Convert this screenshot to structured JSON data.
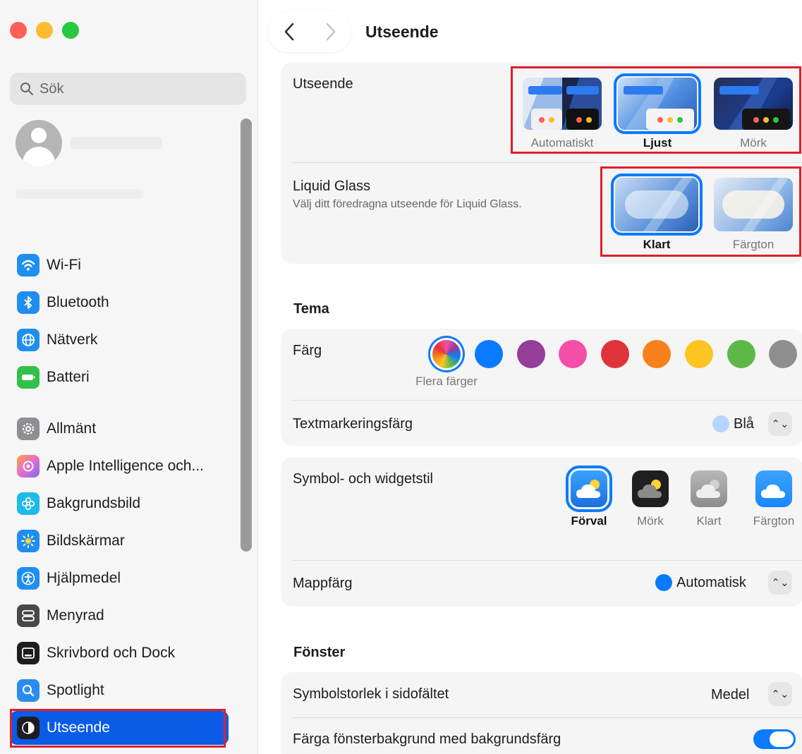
{
  "window": {
    "title": "Utseende"
  },
  "search": {
    "placeholder": "Sök"
  },
  "sidebar": {
    "groups": [
      [
        {
          "label": "Wi-Fi",
          "icon": "wifi-icon",
          "color": "#1e8ef0"
        },
        {
          "label": "Bluetooth",
          "icon": "bluetooth-icon",
          "color": "#1e8ef0"
        },
        {
          "label": "Nätverk",
          "icon": "globe-icon",
          "color": "#1e8ef0"
        },
        {
          "label": "Batteri",
          "icon": "battery-icon",
          "color": "#32c04a"
        }
      ],
      [
        {
          "label": "Allmänt",
          "icon": "gear-icon",
          "color": "#8e8e93"
        },
        {
          "label": "Apple Intelligence och...",
          "icon": "apple-intelligence-icon",
          "color": "#e86bd0"
        },
        {
          "label": "Bakgrundsbild",
          "icon": "flower-icon",
          "color": "#1ebbe8"
        },
        {
          "label": "Bildskärmar",
          "icon": "sun-icon",
          "color": "#1e8ef0"
        },
        {
          "label": "Hjälpmedel",
          "icon": "accessibility-icon",
          "color": "#1e8ef0"
        },
        {
          "label": "Menyrad",
          "icon": "menubar-icon",
          "color": "#48484a"
        },
        {
          "label": "Skrivbord och Dock",
          "icon": "dock-icon",
          "color": "#1d1d1f"
        },
        {
          "label": "Spotlight",
          "icon": "magnifier-icon",
          "color": "#2a8cf0"
        },
        {
          "label": "Utseende",
          "icon": "appearance-icon",
          "color": "#1d1d1f",
          "active": true
        }
      ]
    ]
  },
  "appearance": {
    "label": "Utseende",
    "options": [
      "Automatiskt",
      "Ljust",
      "Mörk"
    ],
    "selected": "Ljust"
  },
  "liquid_glass": {
    "label": "Liquid Glass",
    "description": "Välj ditt föredragna utseende för Liquid Glass.",
    "options": [
      "Klart",
      "Färgton"
    ],
    "selected": "Klart"
  },
  "theme": {
    "heading": "Tema",
    "color_label": "Färg",
    "colors": [
      "multicolor",
      "#0a7bff",
      "#953d9a",
      "#f44ea8",
      "#e0323a",
      "#f7821b",
      "#fdc521",
      "#5eb847",
      "#8e8e8e"
    ],
    "selected_color_name": "Flera färger",
    "highlight_label": "Textmarkeringsfärg",
    "highlight_value": "Blå",
    "highlight_swatch": "#b6d5fc"
  },
  "widget": {
    "label": "Symbol- och widgetstil",
    "options": [
      "Förval",
      "Mörk",
      "Klart",
      "Färgton"
    ],
    "selected": "Förval",
    "folder_label": "Mappfärg",
    "folder_value": "Automatisk",
    "folder_swatch": "#0a7bff"
  },
  "window_section": {
    "heading": "Fönster",
    "icon_size_label": "Symbolstorlek i sidofältet",
    "icon_size_value": "Medel",
    "tint_label": "Färga fönsterbakgrund med bakgrundsfärg",
    "tint_enabled": true
  }
}
